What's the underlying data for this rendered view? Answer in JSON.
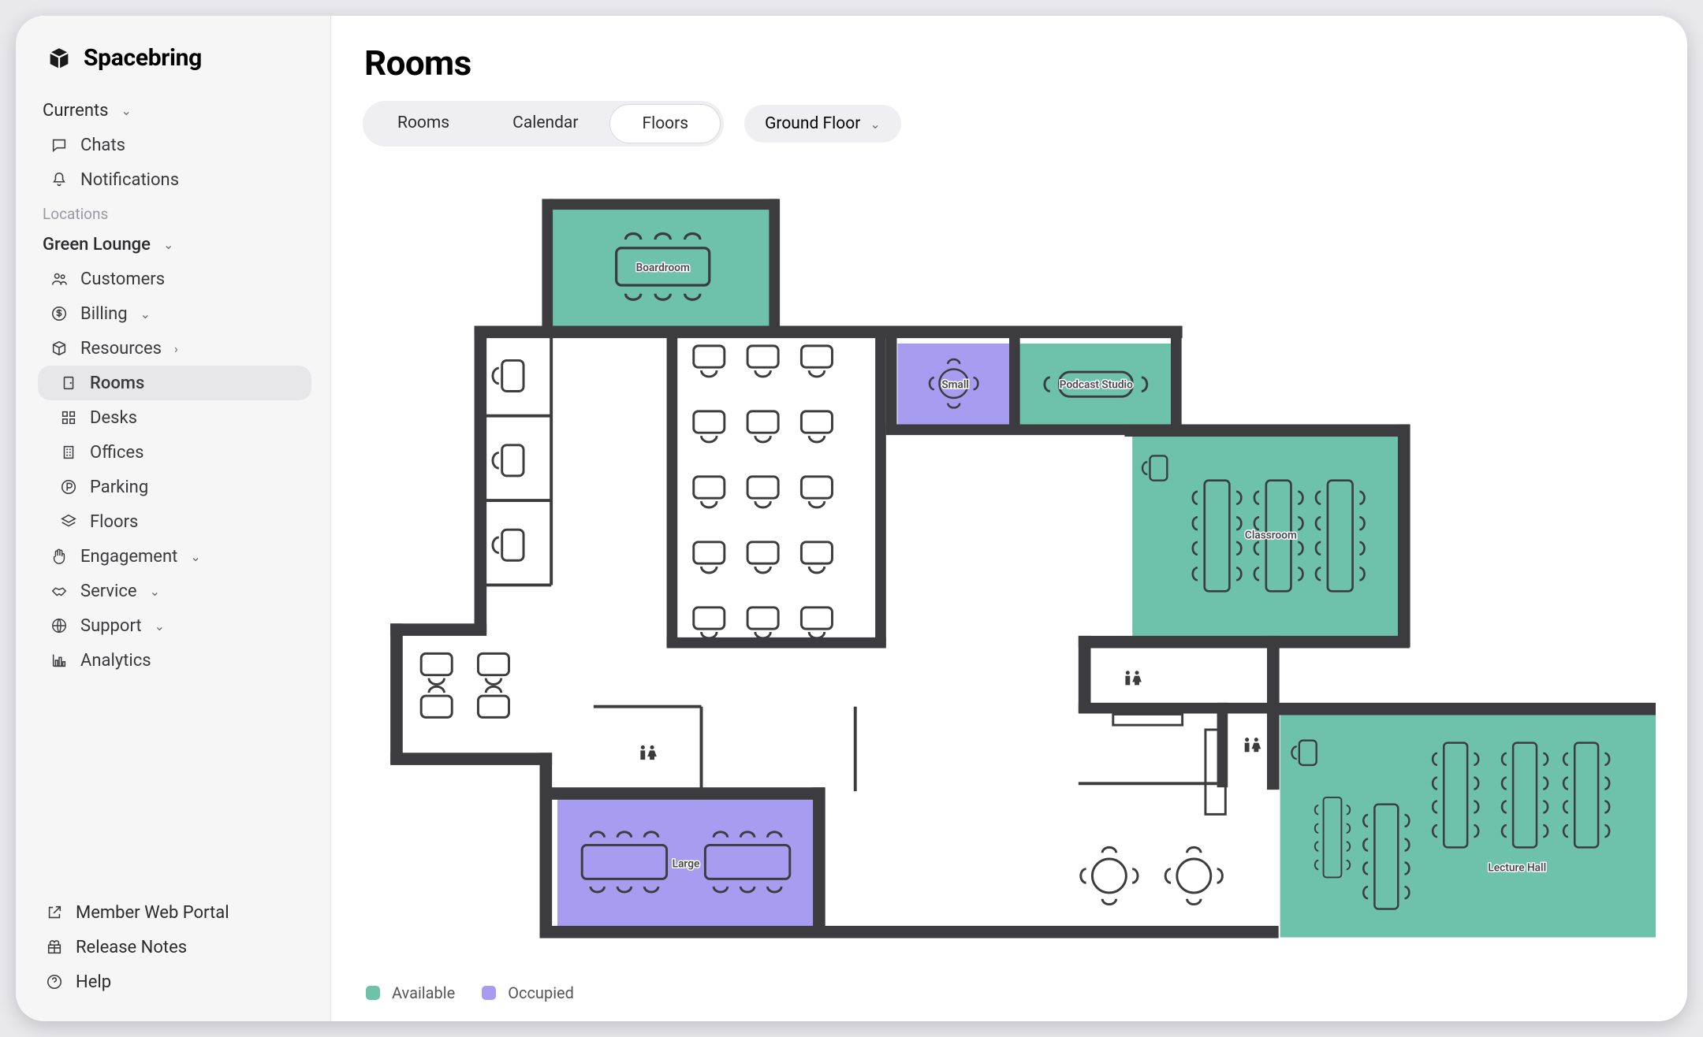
{
  "brand": {
    "name": "Spacebring"
  },
  "sidebar": {
    "workspace_label": "Currents",
    "items_top": [
      {
        "icon": "chat-icon",
        "label": "Chats"
      },
      {
        "icon": "bell-icon",
        "label": "Notifications"
      }
    ],
    "locations_header": "Locations",
    "location_name": "Green Lounge",
    "nav": [
      {
        "icon": "users-icon",
        "label": "Customers",
        "chev": false
      },
      {
        "icon": "dollar-icon",
        "label": "Billing",
        "chev": true
      },
      {
        "icon": "cube-icon",
        "label": "Resources",
        "chev": "right"
      }
    ],
    "resources_children": [
      {
        "icon": "door-icon",
        "label": "Rooms",
        "active": true
      },
      {
        "icon": "grid-icon",
        "label": "Desks"
      },
      {
        "icon": "office-icon",
        "label": "Offices"
      },
      {
        "icon": "parking-icon",
        "label": "Parking"
      },
      {
        "icon": "layers-icon",
        "label": "Floors"
      }
    ],
    "nav_after": [
      {
        "icon": "hand-icon",
        "label": "Engagement",
        "chev": true
      },
      {
        "icon": "handshake-icon",
        "label": "Service",
        "chev": true
      },
      {
        "icon": "globe-icon",
        "label": "Support",
        "chev": true
      },
      {
        "icon": "chart-icon",
        "label": "Analytics",
        "chev": false
      }
    ],
    "bottom": [
      {
        "icon": "external-icon",
        "label": "Member Web Portal"
      },
      {
        "icon": "gift-icon",
        "label": "Release Notes"
      },
      {
        "icon": "help-icon",
        "label": "Help"
      }
    ]
  },
  "page": {
    "title": "Rooms",
    "tabs": [
      {
        "label": "Rooms",
        "active": false
      },
      {
        "label": "Calendar",
        "active": false
      },
      {
        "label": "Floors",
        "active": true
      }
    ],
    "floor_selector": "Ground Floor"
  },
  "legend": {
    "available": "Available",
    "occupied": "Occupied",
    "available_color": "#6dc2a9",
    "occupied_color": "#a89cf0"
  },
  "rooms": {
    "boardroom": {
      "label": "Boardroom",
      "status": "available"
    },
    "small": {
      "label": "Small",
      "status": "occupied"
    },
    "podcast_studio": {
      "label": "Podcast Studio",
      "status": "available"
    },
    "classroom": {
      "label": "Classroom",
      "status": "available"
    },
    "large": {
      "label": "Large",
      "status": "occupied"
    },
    "lecture_hall": {
      "label": "Lecture Hall",
      "status": "available"
    }
  }
}
